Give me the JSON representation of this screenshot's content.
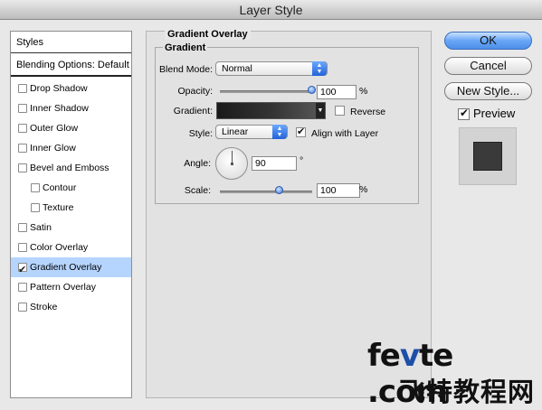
{
  "window": {
    "title": "Layer Style"
  },
  "styles": {
    "header": "Styles",
    "blending_options": "Blending Options: Default",
    "items": [
      {
        "label": "Drop Shadow",
        "checked": false,
        "indent": false,
        "selected": false
      },
      {
        "label": "Inner Shadow",
        "checked": false,
        "indent": false,
        "selected": false
      },
      {
        "label": "Outer Glow",
        "checked": false,
        "indent": false,
        "selected": false
      },
      {
        "label": "Inner Glow",
        "checked": false,
        "indent": false,
        "selected": false
      },
      {
        "label": "Bevel and Emboss",
        "checked": false,
        "indent": false,
        "selected": false
      },
      {
        "label": "Contour",
        "checked": false,
        "indent": true,
        "selected": false
      },
      {
        "label": "Texture",
        "checked": false,
        "indent": true,
        "selected": false
      },
      {
        "label": "Satin",
        "checked": false,
        "indent": false,
        "selected": false
      },
      {
        "label": "Color Overlay",
        "checked": false,
        "indent": false,
        "selected": false
      },
      {
        "label": "Gradient Overlay",
        "checked": true,
        "indent": false,
        "selected": true
      },
      {
        "label": "Pattern Overlay",
        "checked": false,
        "indent": false,
        "selected": false
      },
      {
        "label": "Stroke",
        "checked": false,
        "indent": false,
        "selected": false
      }
    ]
  },
  "panel": {
    "title": "Gradient Overlay",
    "group": "Gradient",
    "blend_mode": {
      "label": "Blend Mode:",
      "value": "Normal"
    },
    "opacity": {
      "label": "Opacity:",
      "value": "100",
      "unit": "%",
      "fraction": 1.0
    },
    "gradient": {
      "label": "Gradient:",
      "reverse_label": "Reverse",
      "reverse_checked": false
    },
    "style": {
      "label": "Style:",
      "value": "Linear",
      "align_label": "Align with Layer",
      "align_checked": true
    },
    "angle": {
      "label": "Angle:",
      "value": "90",
      "unit": "°"
    },
    "scale": {
      "label": "Scale:",
      "value": "100",
      "unit": "%",
      "fraction": 0.65
    }
  },
  "buttons": {
    "ok": "OK",
    "cancel": "Cancel",
    "new_style": "New Style...",
    "preview_label": "Preview",
    "preview_checked": true
  },
  "watermark": {
    "line1_a": "fe",
    "line1_b": "v",
    "line1_c": "te .com",
    "line2": "飞特教程网"
  },
  "colors": {
    "accent": "#4d8fe8",
    "selection": "#b5d5ff"
  }
}
